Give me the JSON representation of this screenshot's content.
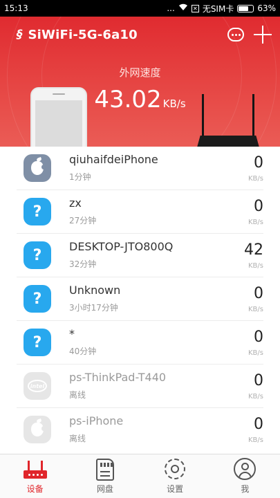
{
  "status_bar": {
    "time": "15:13",
    "signal_dots": "...",
    "sim_text": "无SIM卡",
    "battery": "63%",
    "battery_level": 0.63
  },
  "header": {
    "app_title": "SiWiFi-5G-6a10",
    "speed_label": "外网速度",
    "speed_value": "43.02",
    "speed_unit": "KB/s",
    "icons": {
      "logo": "siwifi-logo-icon",
      "message": "chat-bubble-icon",
      "add": "plus-icon"
    }
  },
  "devices": [
    {
      "name": "qiuhaifdeiPhone",
      "time": "1分钟",
      "rate": "0",
      "unit": "KB/s",
      "icon": "apple-icon",
      "online": true
    },
    {
      "name": "zx",
      "time": "27分钟",
      "rate": "0",
      "unit": "KB/s",
      "icon": "question-icon",
      "online": true
    },
    {
      "name": "DESKTOP-JTO800Q",
      "time": "32分钟",
      "rate": "42",
      "unit": "KB/s",
      "icon": "question-icon",
      "online": true
    },
    {
      "name": "Unknown",
      "time": "3小时17分钟",
      "rate": "0",
      "unit": "KB/s",
      "icon": "question-icon",
      "online": true
    },
    {
      "name": "*",
      "time": "40分钟",
      "rate": "0",
      "unit": "KB/s",
      "icon": "question-icon",
      "online": true
    },
    {
      "name": "ps-ThinkPad-T440",
      "time": "离线",
      "rate": "0",
      "unit": "KB/s",
      "icon": "intel-icon",
      "online": false
    },
    {
      "name": "ps-iPhone",
      "time": "离线",
      "rate": "0",
      "unit": "KB/s",
      "icon": "apple-icon",
      "online": false
    }
  ],
  "tabs": [
    {
      "label": "设备",
      "icon": "router-icon",
      "active": true
    },
    {
      "label": "网盘",
      "icon": "sd-card-icon",
      "active": false
    },
    {
      "label": "设置",
      "icon": "gear-icon",
      "active": false
    },
    {
      "label": "我",
      "icon": "user-icon",
      "active": false
    }
  ],
  "colors": {
    "accent": "#e0262b",
    "unknown_device": "#28a8ee",
    "apple_device": "#7f8fa6"
  }
}
